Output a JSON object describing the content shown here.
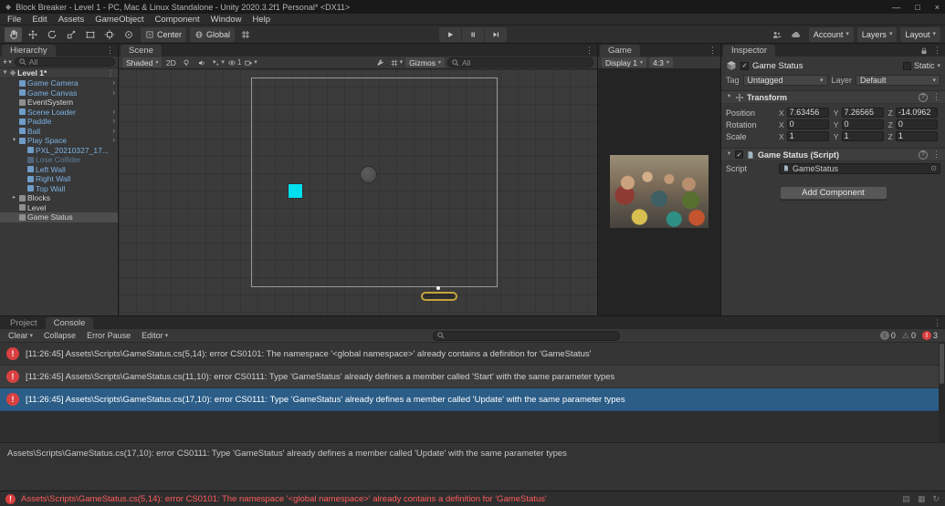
{
  "window": {
    "title": "Block Breaker - Level 1 - PC, Mac & Linux Standalone - Unity 2020.3.2f1 Personal* <DX11>"
  },
  "menu": {
    "items": [
      "File",
      "Edit",
      "Assets",
      "GameObject",
      "Component",
      "Window",
      "Help"
    ]
  },
  "toolbar": {
    "pivot": "Center",
    "orientation": "Global",
    "account": "Account",
    "layers": "Layers",
    "layout": "Layout"
  },
  "hierarchy": {
    "tab": "Hierarchy",
    "search_placeholder": "All",
    "scene_name": "Level 1*",
    "items": [
      {
        "label": "Game Camera",
        "color": "prefab",
        "indent": 1,
        "expander": "none",
        "prefab_arrow": true,
        "selected": false
      },
      {
        "label": "Game Canvas",
        "color": "prefab",
        "indent": 1,
        "expander": "none",
        "prefab_arrow": true,
        "selected": false
      },
      {
        "label": "EventSystem",
        "color": "normal",
        "indent": 1,
        "expander": "none",
        "prefab_arrow": false,
        "selected": false
      },
      {
        "label": "Scene Loader",
        "color": "prefab",
        "indent": 1,
        "expander": "none",
        "prefab_arrow": true,
        "selected": false
      },
      {
        "label": "Paddle",
        "color": "prefab",
        "indent": 1,
        "expander": "none",
        "prefab_arrow": true,
        "selected": false
      },
      {
        "label": "Ball",
        "color": "prefab",
        "indent": 1,
        "expander": "none",
        "prefab_arrow": true,
        "selected": false
      },
      {
        "label": "Play Space",
        "color": "prefab",
        "indent": 1,
        "expander": "expanded",
        "prefab_arrow": true,
        "selected": false
      },
      {
        "label": "PXL_20210327_17...",
        "color": "prefab",
        "indent": 2,
        "expander": "none",
        "prefab_arrow": false,
        "selected": false
      },
      {
        "label": "Lose Collider",
        "color": "prefab-disabled",
        "indent": 2,
        "expander": "none",
        "prefab_arrow": false,
        "selected": false
      },
      {
        "label": "Left Wall",
        "color": "prefab",
        "indent": 2,
        "expander": "none",
        "prefab_arrow": false,
        "selected": false
      },
      {
        "label": "Right Wall",
        "color": "prefab",
        "indent": 2,
        "expander": "none",
        "prefab_arrow": false,
        "selected": false
      },
      {
        "label": "Top Wall",
        "color": "prefab",
        "indent": 2,
        "expander": "none",
        "prefab_arrow": false,
        "selected": false
      },
      {
        "label": "Blocks",
        "color": "normal",
        "indent": 1,
        "expander": "collapsed",
        "prefab_arrow": false,
        "selected": false
      },
      {
        "label": "Level",
        "color": "normal",
        "indent": 1,
        "expander": "none",
        "prefab_arrow": false,
        "selected": false
      },
      {
        "label": "Game Status",
        "color": "normal",
        "indent": 1,
        "expander": "none",
        "prefab_arrow": false,
        "selected": true
      }
    ]
  },
  "scene_view": {
    "tab": "Scene",
    "shading": "Shaded",
    "mode_2d": "2D",
    "visibility_count": "1",
    "gizmos": "Gizmos",
    "search_placeholder": "All"
  },
  "game_view": {
    "tab": "Game",
    "display": "Display 1",
    "aspect": "4:3"
  },
  "inspector": {
    "tab": "Inspector",
    "gameobject": {
      "name": "Game Status",
      "static_label": "Static",
      "tag_label": "Tag",
      "tag_value": "Untagged",
      "layer_label": "Layer",
      "layer_value": "Default"
    },
    "transform": {
      "title": "Transform",
      "axis_labels": [
        "X",
        "Y",
        "Z"
      ],
      "rows": [
        {
          "label": "Position",
          "values": [
            "7.63456",
            "7.26565",
            "-14.0962"
          ]
        },
        {
          "label": "Rotation",
          "values": [
            "0",
            "0",
            "0"
          ]
        },
        {
          "label": "Scale",
          "values": [
            "1",
            "1",
            "1"
          ]
        }
      ]
    },
    "script_component": {
      "title": "Game Status (Script)",
      "script_label": "Script",
      "script_value": "GameStatus"
    },
    "add_component": "Add Component"
  },
  "console": {
    "tab_project": "Project",
    "tab_console": "Console",
    "toolbar": {
      "clear": "Clear",
      "collapse": "Collapse",
      "error_pause": "Error Pause",
      "editor": "Editor"
    },
    "counts": {
      "info": "0",
      "warning": "0",
      "error": "3"
    },
    "entries": [
      {
        "text": "[11:26:45] Assets\\Scripts\\GameStatus.cs(5,14): error CS0101: The namespace '<global namespace>' already contains a definition for 'GameStatus'",
        "selected": false
      },
      {
        "text": "[11:26:45] Assets\\Scripts\\GameStatus.cs(11,10): error CS0111: Type 'GameStatus' already defines a member called 'Start' with the same parameter types",
        "selected": false
      },
      {
        "text": "[11:26:45] Assets\\Scripts\\GameStatus.cs(17,10): error CS0111: Type 'GameStatus' already defines a member called 'Update' with the same parameter types",
        "selected": true
      }
    ],
    "detail": "Assets\\Scripts\\GameStatus.cs(17,10): error CS0111: Type 'GameStatus' already defines a member called 'Update' with the same parameter types"
  },
  "status_bar": {
    "message": "Assets\\Scripts\\GameStatus.cs(5,14): error CS0101: The namespace '<global namespace>' already contains a definition for 'GameStatus'"
  },
  "icons": {
    "foldout_open": "▾",
    "foldout_closed": "▸",
    "dropdown_caret": "▾",
    "menu_dots": "⋮",
    "prefab_arrow": "›",
    "checkmark": "✓",
    "minimize": "—",
    "maximize": "□",
    "close": "×",
    "error_glyph": "!",
    "info_glyph": "!",
    "warning_glyph": "⚠",
    "help_glyph": "?",
    "picker_glyph": "⊙",
    "plus": "+",
    "unity_logo": "◆",
    "status_console": "▤",
    "status_cache": "▦",
    "status_tasks": "↻"
  },
  "colors": {
    "prefab_text": "#7cb2e2",
    "prefab_disabled_text": "#5d7e9c",
    "hierarchy_selection": "#4d4d4d",
    "console_selection": "#2b5d87",
    "error_red": "#d94040",
    "status_error_text": "#ff5c5c",
    "block_cyan": "#00dff0",
    "paddle_yellow": "#c4a43d"
  }
}
